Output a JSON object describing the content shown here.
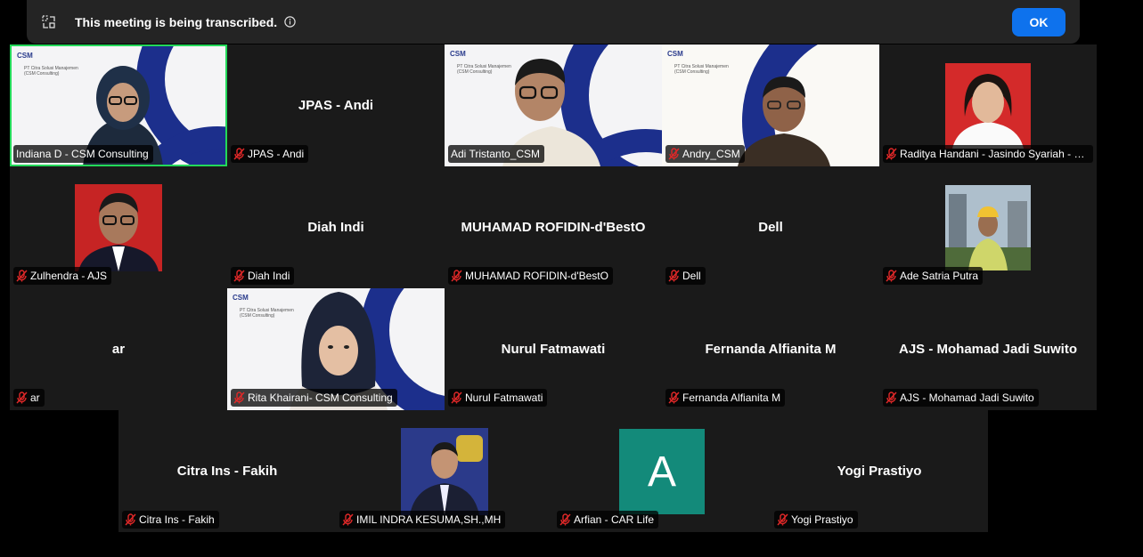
{
  "banner": {
    "message": "This meeting is being transcribed.",
    "ok_label": "OK"
  },
  "participants": [
    {
      "display": "Indiana D - CSM Consulting",
      "big": ""
    },
    {
      "display": "JPAS - Andi",
      "big": "JPAS - Andi"
    },
    {
      "display": "Adi Tristanto_CSM",
      "big": ""
    },
    {
      "display": "Andry_CSM",
      "big": ""
    },
    {
      "display": "Raditya Handani - Jasindo Syariah - Ja...",
      "big": ""
    },
    {
      "display": "Zulhendra - AJS",
      "big": ""
    },
    {
      "display": "Diah Indi",
      "big": "Diah Indi"
    },
    {
      "display": "MUHAMAD ROFIDIN-d'BestO",
      "big": "MUHAMAD ROFIDIN-d'BestO"
    },
    {
      "display": "Dell",
      "big": "Dell"
    },
    {
      "display": "Ade Satria Putra",
      "big": ""
    },
    {
      "display": "ar",
      "big": "ar"
    },
    {
      "display": "Rita Khairani- CSM Consulting",
      "big": ""
    },
    {
      "display": "Nurul Fatmawati",
      "big": "Nurul Fatmawati"
    },
    {
      "display": "Fernanda Alfianita M",
      "big": "Fernanda Alfianita M"
    },
    {
      "display": "AJS - Mohamad Jadi Suwito",
      "big": "AJS - Mohamad Jadi Suwito"
    },
    {
      "display": "Citra Ins - Fakih",
      "big": "Citra Ins - Fakih"
    },
    {
      "display": "IMIL INDRA KESUMA,SH.,MH",
      "big": ""
    },
    {
      "display": "Arfian - CAR Life",
      "big": "",
      "avatar_letter": "A"
    },
    {
      "display": "Yogi Prastiyo",
      "big": "Yogi Prastiyo"
    }
  ],
  "csm_logo": "CSM",
  "csm_company": "PT Citra Solusi Manajemen",
  "csm_company_sub": "(CSM Consulting)",
  "colors": {
    "active_speaker": "#23d959",
    "muted": "#e02828",
    "ok_button": "#0e72ed",
    "avatar_teal": "#138a7a",
    "csm_blue": "#1c2f8c"
  },
  "icons": {
    "transcript": "transcript-icon",
    "info": "info-icon",
    "muted_mic": "muted-mic-icon"
  }
}
